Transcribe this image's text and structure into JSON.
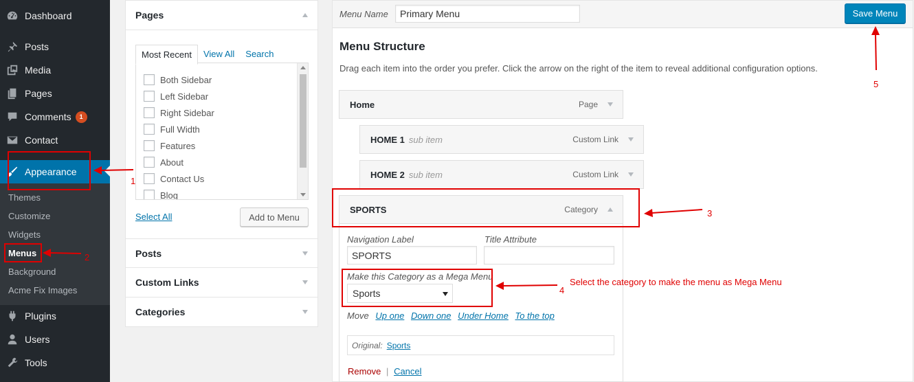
{
  "sidebar": {
    "items": [
      {
        "label": "Dashboard",
        "icon": "dashboard-icon"
      },
      {
        "label": "Posts",
        "icon": "pin-icon"
      },
      {
        "label": "Media",
        "icon": "media-icon"
      },
      {
        "label": "Pages",
        "icon": "page-icon"
      },
      {
        "label": "Comments",
        "icon": "comment-icon",
        "badge": "1"
      },
      {
        "label": "Contact",
        "icon": "mail-icon"
      },
      {
        "label": "Appearance",
        "icon": "brush-icon",
        "current": true
      },
      {
        "label": "Plugins",
        "icon": "plugin-icon"
      },
      {
        "label": "Users",
        "icon": "user-icon"
      },
      {
        "label": "Tools",
        "icon": "wrench-icon"
      }
    ],
    "submenu": [
      "Themes",
      "Customize",
      "Widgets",
      "Menus",
      "Background",
      "Acme Fix Images"
    ],
    "submenu_current": "Menus"
  },
  "add_items": {
    "pages_title": "Pages",
    "tabs": [
      "Most Recent",
      "View All",
      "Search"
    ],
    "pages": [
      "Both Sidebar",
      "Left Sidebar",
      "Right Sidebar",
      "Full Width",
      "Features",
      "About",
      "Contact Us",
      "Blog"
    ],
    "select_all": "Select All",
    "add_to_menu": "Add to Menu",
    "sections": [
      "Posts",
      "Custom Links",
      "Categories"
    ]
  },
  "editor": {
    "menu_name_label": "Menu Name",
    "menu_name_value": "Primary Menu",
    "save_button": "Save Menu",
    "structure_title": "Menu Structure",
    "structure_desc": "Drag each item into the order you prefer. Click the arrow on the right of the item to reveal additional configuration options.",
    "items": [
      {
        "title": "Home",
        "sub": "",
        "type": "Page"
      },
      {
        "title": "HOME 1",
        "sub": "sub item",
        "type": "Custom Link"
      },
      {
        "title": "HOME 2",
        "sub": "sub item",
        "type": "Custom Link"
      },
      {
        "title": "SPORTS",
        "sub": "",
        "type": "Category"
      }
    ],
    "settings": {
      "nav_label": "Navigation Label",
      "nav_value": "SPORTS",
      "title_attr": "Title Attribute",
      "title_attr_value": "",
      "mega_label": "Make this Category as a Mega Menu",
      "mega_value": "Sports",
      "move_label": "Move",
      "move_links": [
        "Up one",
        "Down one",
        "Under Home",
        "To the top"
      ],
      "original_label": "Original:",
      "original_link": "Sports",
      "remove": "Remove",
      "separator": "|",
      "cancel": "Cancel"
    }
  },
  "annotations": {
    "n1": "1",
    "n2": "2",
    "n3": "3",
    "n4": "4",
    "n5": "5",
    "text4": "Select the category to make the menu as Mega Menu",
    "color": "#e00000"
  }
}
